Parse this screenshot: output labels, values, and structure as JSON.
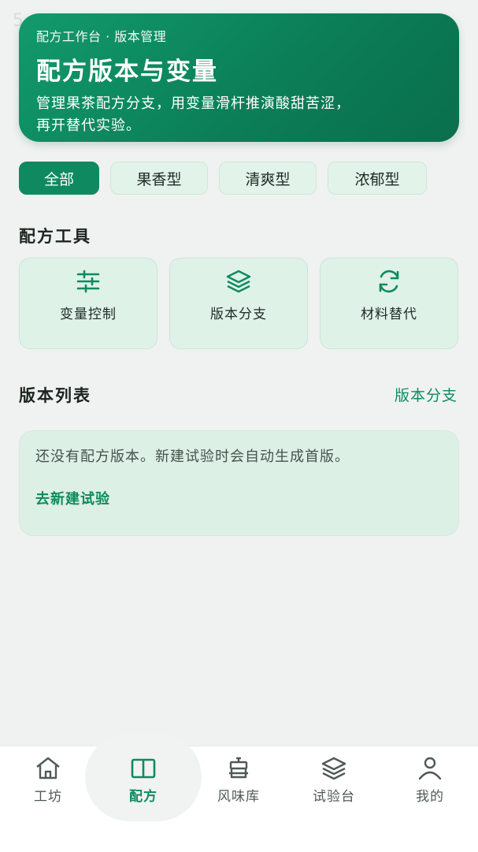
{
  "status_number": "5",
  "hero": {
    "breadcrumb": "配方工作台 · 版本管理",
    "title": "配方版本与变量",
    "description_line1": "管理果茶配方分支，用变量滑杆推演酸甜苦涩，",
    "description_line2": "再开替代实验。"
  },
  "filters": [
    "全部",
    "果香型",
    "清爽型",
    "浓郁型"
  ],
  "tools_section": {
    "title": "配方工具",
    "items": [
      {
        "label": "变量控制",
        "icon": "sliders-icon"
      },
      {
        "label": "版本分支",
        "icon": "layers-icon"
      },
      {
        "label": "材料替代",
        "icon": "refresh-icon"
      }
    ]
  },
  "versions_section": {
    "title": "版本列表",
    "link": "版本分支",
    "empty_message": "还没有配方版本。新建试验时会自动生成首版。",
    "empty_action": "去新建试验"
  },
  "tabbar": [
    {
      "label": "工坊",
      "icon": "home-icon"
    },
    {
      "label": "配方",
      "icon": "book-icon"
    },
    {
      "label": "风味库",
      "icon": "pot-icon"
    },
    {
      "label": "试验台",
      "icon": "layers-icon"
    },
    {
      "label": "我的",
      "icon": "user-icon"
    }
  ],
  "colors": {
    "accent": "#0f8a60",
    "hero_start": "#129a6c",
    "hero_end": "#0a6e4c",
    "card_bg": "#dff2e8",
    "page_bg": "#eff2f0"
  }
}
